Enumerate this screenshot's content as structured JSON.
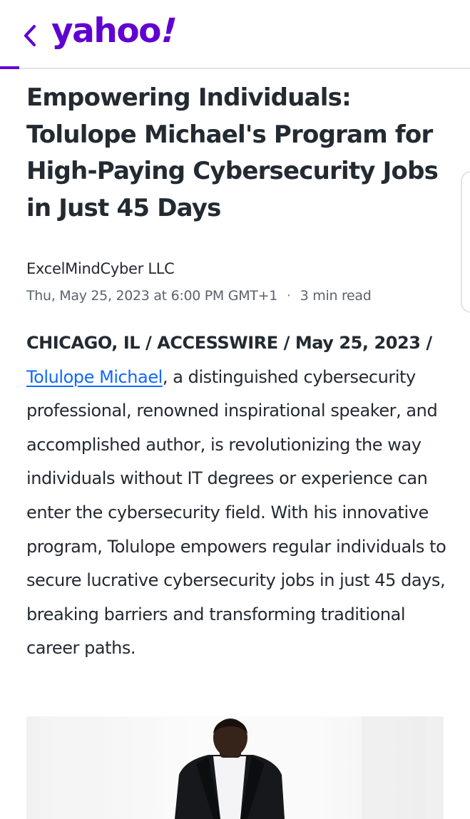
{
  "header": {
    "back_icon": "chevron-left-icon",
    "logo_text": "yahoo",
    "logo_bang": "!",
    "brand_color": "#6001d2"
  },
  "article": {
    "title": "Empowering Individuals: Tolulope Michael's Program for High-Paying Cybersecurity Jobs in Just 45 Days",
    "provider": "ExcelMindCyber LLC",
    "date": "Thu, May 25, 2023 at 6:00 PM GMT+1",
    "separator": "·",
    "read_time": "3 min read",
    "dateline": "CHICAGO, IL / ACCESSWIRE / May 25, 2023 /",
    "link_text": "Tolulope Michael",
    "body_text": ", a distinguished cybersecurity professional, renowned inspirational speaker, and accomplished author, is revolutionizing the way individuals without IT degrees or experience can enter the cybersecurity field. With his innovative program, Tolulope empowers regular individuals to secure lucrative cybersecurity jobs in just 45 days, breaking barriers and transforming traditional career paths.",
    "link_color": "#0f69ff"
  },
  "hero_image": {
    "subject": "man-in-suit-photo"
  }
}
